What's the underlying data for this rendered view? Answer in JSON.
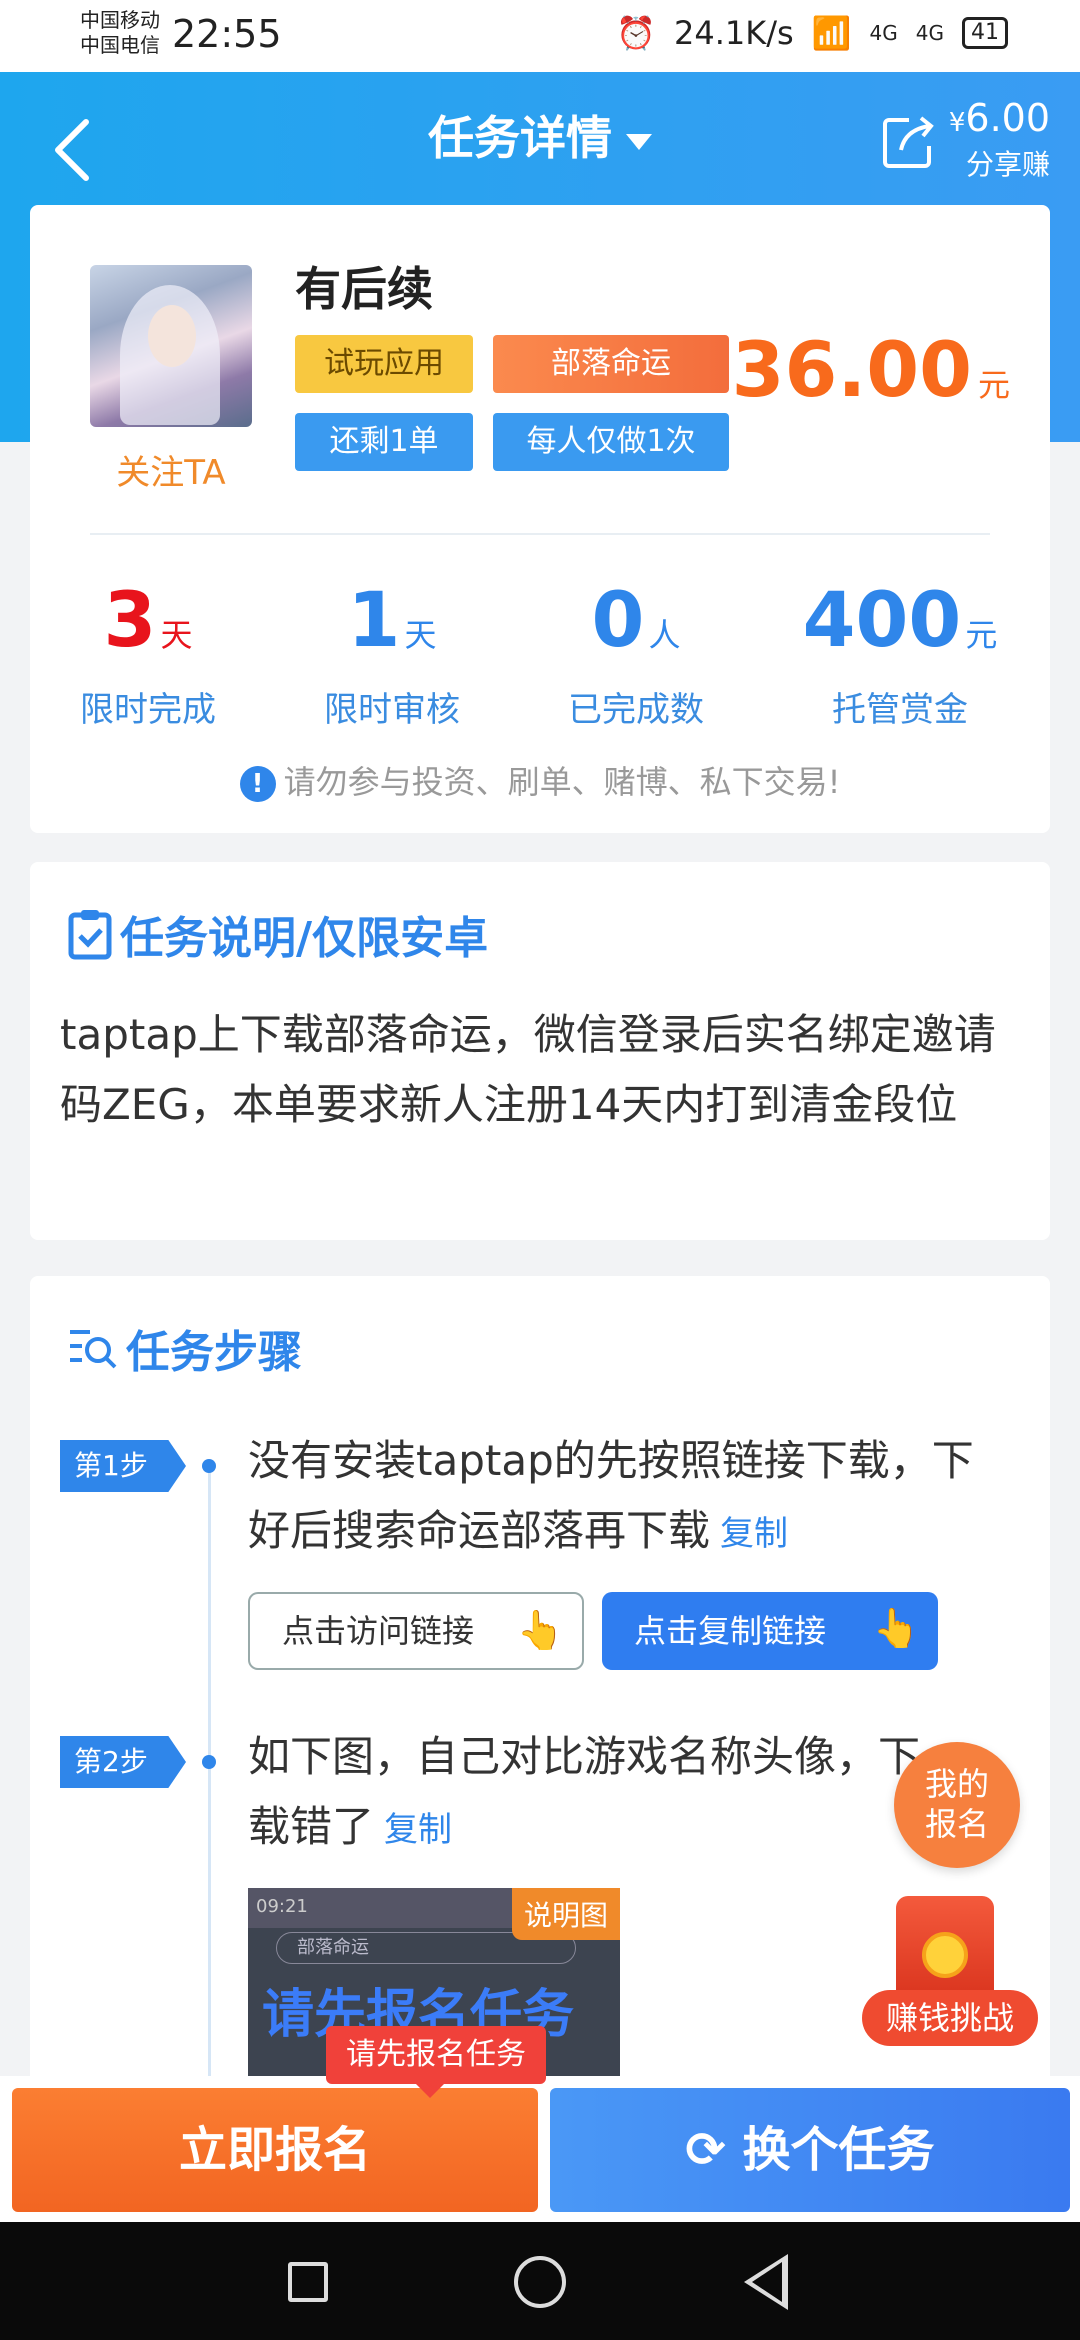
{
  "status": {
    "carrier1": "中国移动",
    "carrier2": "中国电信",
    "time": "22:55",
    "speed": "24.1K/s",
    "net1": "4G",
    "net2": "4G",
    "battery": "41"
  },
  "header": {
    "title": "任务详情",
    "share_amount": "6.00",
    "share_currency": "¥",
    "share_label": "分享赚"
  },
  "task": {
    "name": "有后续",
    "follow": "关注TA",
    "tags": [
      "试玩应用",
      "部落命运",
      "还剩1单",
      "每人仅做1次"
    ],
    "price": "36.00",
    "price_unit": "元",
    "stats": [
      {
        "num": "3",
        "unit": "天",
        "label": "限时完成",
        "color": "#e8141c"
      },
      {
        "num": "1",
        "unit": "天",
        "label": "限时审核",
        "color": "#2f86ea"
      },
      {
        "num": "0",
        "unit": "人",
        "label": "已完成数",
        "color": "#2f86ea"
      },
      {
        "num": "400",
        "unit": "元",
        "label": "托管赏金",
        "color": "#2f86ea"
      }
    ],
    "warning": "请勿参与投资、刷单、赌博、私下交易!"
  },
  "description": {
    "title": "任务说明/仅限安卓",
    "text": "taptap上下载部落命运，微信登录后实名绑定邀请码ZEG，本单要求新人注册14天内打到清金段位"
  },
  "steps": {
    "title": "任务步骤",
    "items": [
      {
        "badge": "第1步",
        "text": "没有安装taptap的先按照链接下载，下好后搜索命运部落再下载",
        "copy": "复制"
      },
      {
        "badge": "第2步",
        "text": "如下图，自己对比游戏名称头像，下载错了",
        "copy": "复制"
      }
    ],
    "btn_visit": "点击访问链接",
    "btn_copy": "点击复制链接",
    "shot_tag": "说明图",
    "shot_time": "09:21",
    "shot_search": "部落命运",
    "shot_text": "请先报名任务"
  },
  "floating": {
    "my_signup": [
      "我的",
      "报名"
    ],
    "earn": "赚钱挑战"
  },
  "bottom": {
    "tooltip": "请先报名任务",
    "signup": "立即报名",
    "switch": "换个任务"
  }
}
